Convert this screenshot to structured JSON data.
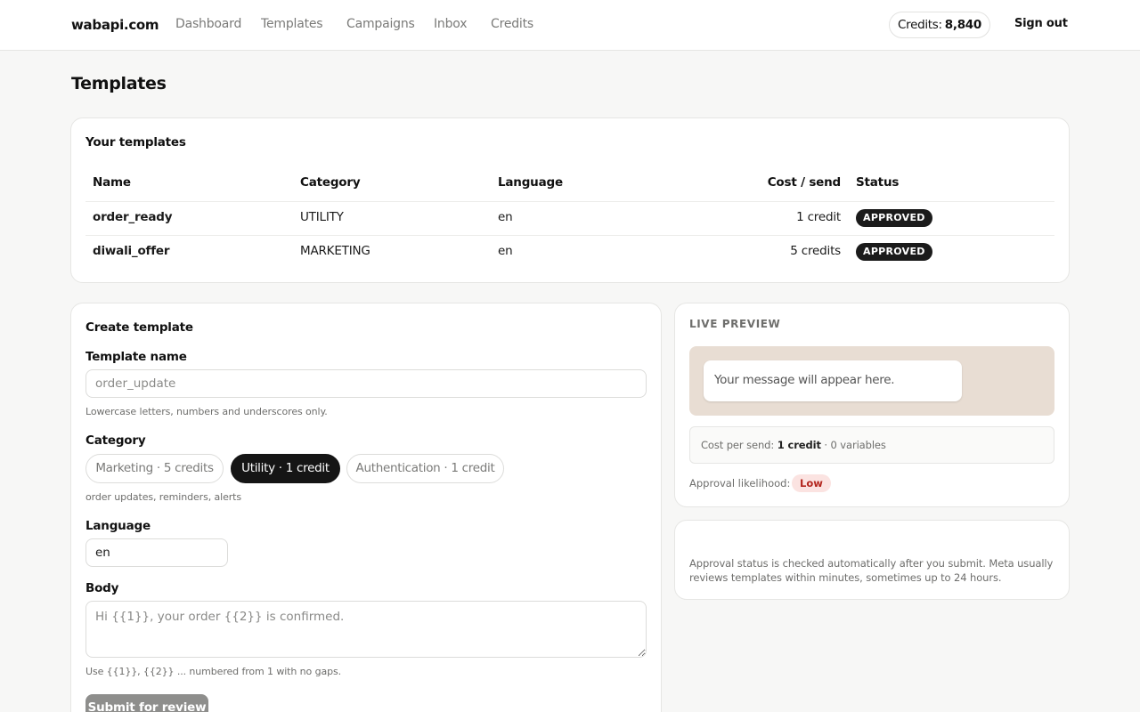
{
  "header": {
    "brand": "wabapi.com",
    "nav": [
      "Dashboard",
      "Templates",
      "Campaigns",
      "Inbox",
      "Credits"
    ],
    "credits_label": "Credits:",
    "credits_value": "8,840",
    "signout": "Sign out"
  },
  "page": {
    "title": "Templates"
  },
  "templates_table": {
    "title": "Your templates",
    "columns": [
      "Name",
      "Category",
      "Language",
      "Cost / send",
      "Status"
    ],
    "rows": [
      {
        "name": "order_ready",
        "category": "UTILITY",
        "language": "en",
        "cost": "1 credit",
        "status": "APPROVED"
      },
      {
        "name": "diwali_offer",
        "category": "MARKETING",
        "language": "en",
        "cost": "5 credits",
        "status": "APPROVED"
      }
    ]
  },
  "create_form": {
    "title": "Create template",
    "name_label": "Template name",
    "name_placeholder": "order_update",
    "name_hint": "Lowercase letters, numbers and underscores only.",
    "category_label": "Category",
    "category_options": [
      "Marketing · 5 credits",
      "Utility · 1 credit",
      "Authentication · 1 credit"
    ],
    "category_selected": "Utility · 1 credit",
    "category_hint": "order updates, reminders, alerts",
    "language_label": "Language",
    "language_value": "en",
    "body_label": "Body",
    "body_placeholder": "Hi {{1}}, your order {{2}} is confirmed.",
    "body_hint": "Use {{1}}, {{2}} ... numbered from 1 with no gaps.",
    "submit_label": "Submit for review"
  },
  "preview": {
    "heading": "LIVE PREVIEW",
    "bubble_text": "Your message will appear here.",
    "cost_label": "Cost per send:",
    "cost_value": "1 credit",
    "variables_text": "· 0 variables",
    "approval_label": "Approval likelihood:",
    "approval_value": "Low",
    "colors": {
      "chat_bg": "#e8ddd3",
      "low_bg": "#fbe3e1",
      "low_text": "#b3261e"
    }
  },
  "info_note": {
    "text": "Approval status is checked automatically after you submit. Meta usually reviews templates within minutes, sometimes up to 24 hours."
  }
}
